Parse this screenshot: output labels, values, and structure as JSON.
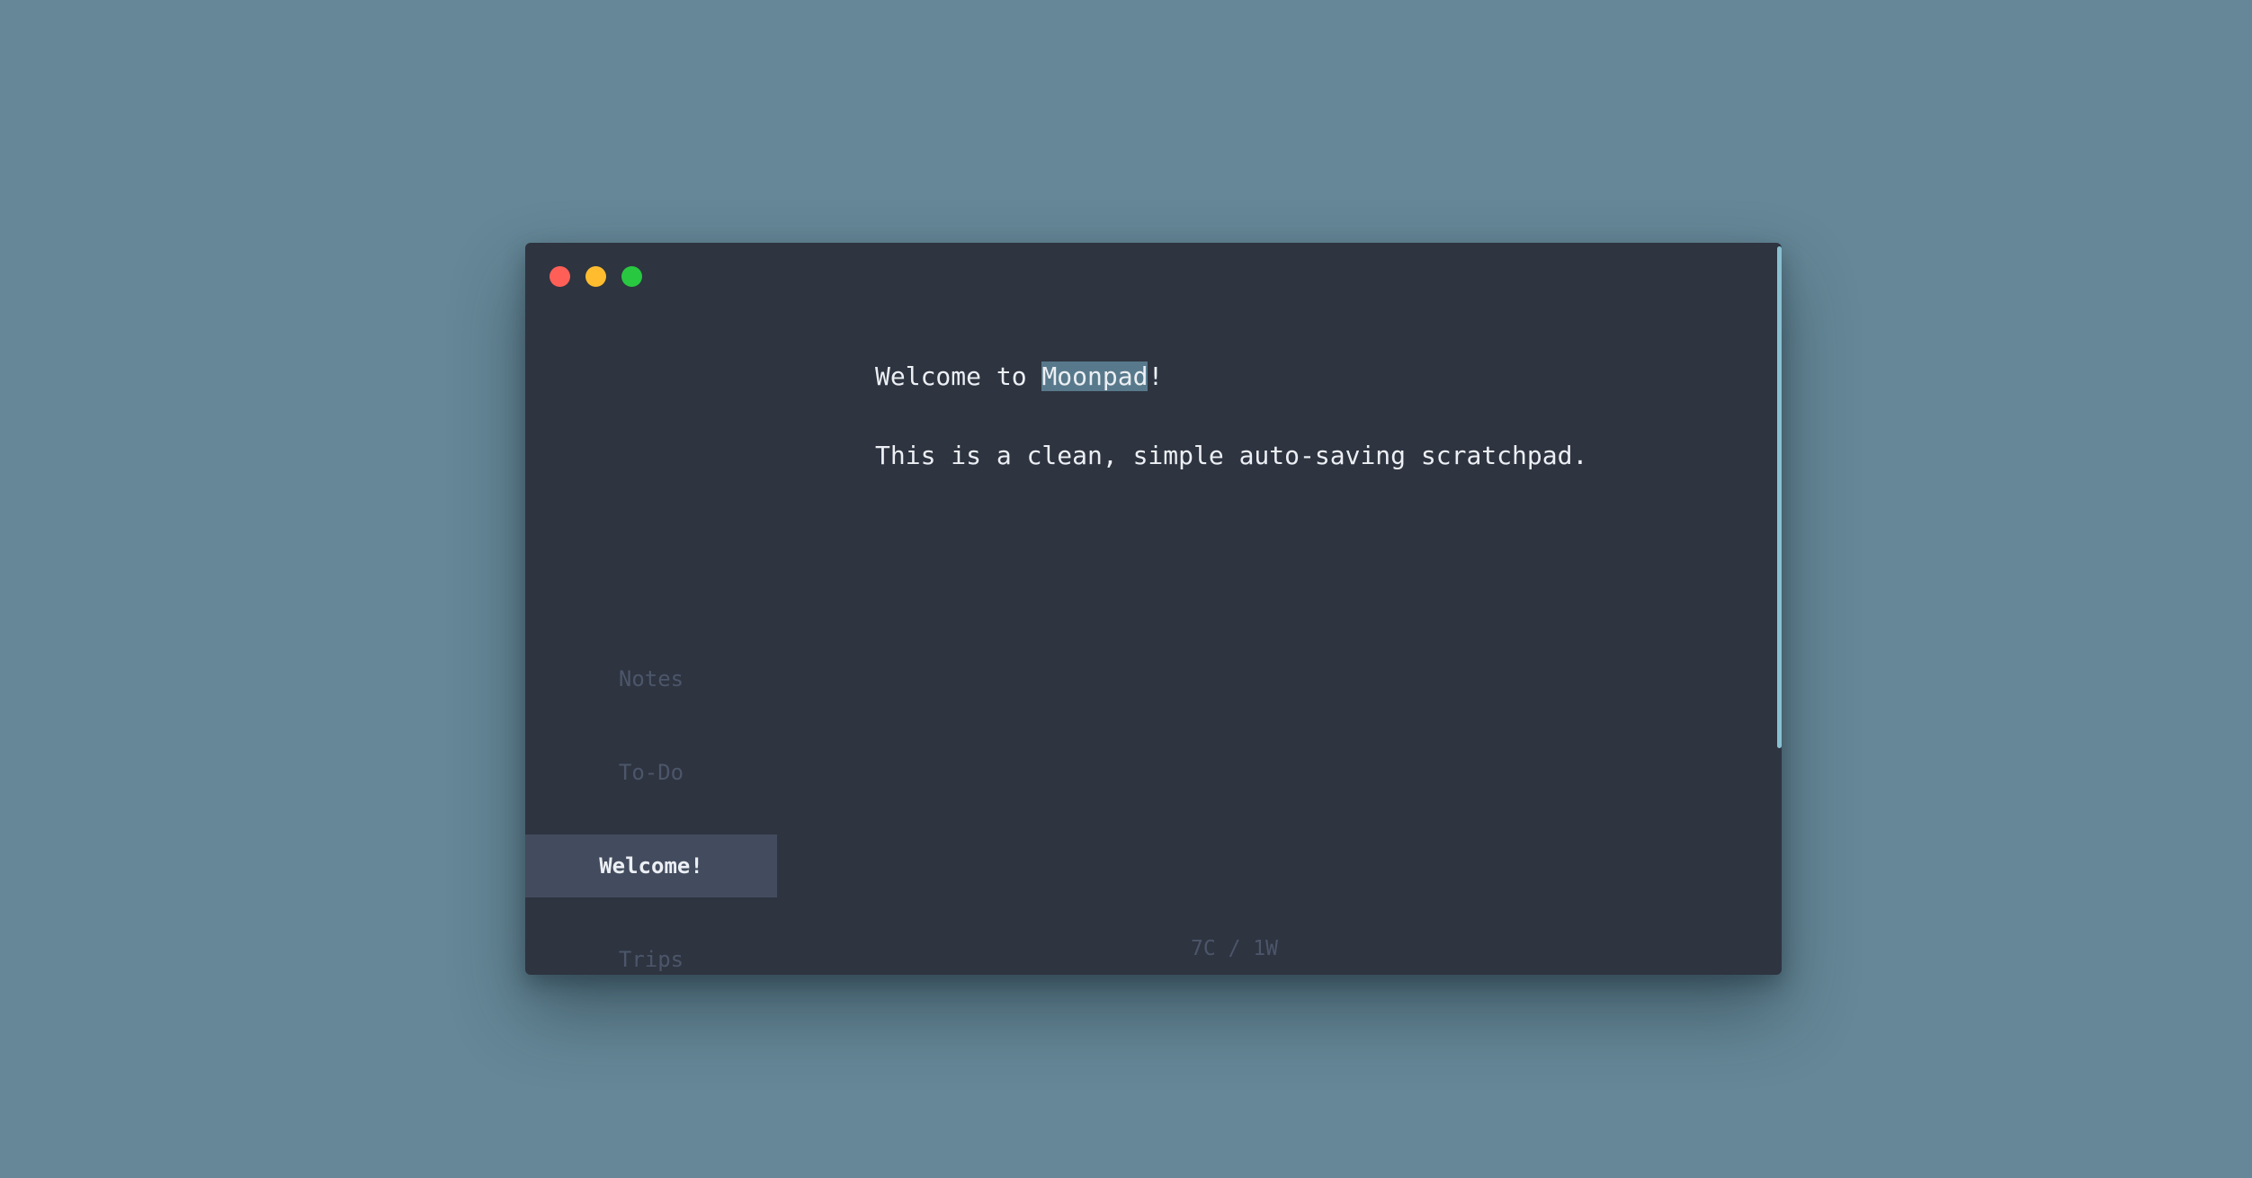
{
  "window": {
    "controls": [
      "close",
      "minimize",
      "maximize"
    ]
  },
  "sidebar": {
    "tabs": [
      {
        "label": "Notes",
        "active": false
      },
      {
        "label": "To-Do",
        "active": false
      },
      {
        "label": "Welcome!",
        "active": true
      },
      {
        "label": "Trips",
        "active": false
      }
    ],
    "add_label": "+"
  },
  "editor": {
    "line1_before": "Welcome to ",
    "line1_selected": "Moonpad",
    "line1_after": "!",
    "line2": "This is a clean, simple auto-saving scratchpad."
  },
  "status": {
    "counter": "7C / 1W"
  },
  "colors": {
    "background": "#658797",
    "window": "#2e3440",
    "active_tab": "#434c5e",
    "selection": "#58798b",
    "accent": "#88c0d0"
  }
}
